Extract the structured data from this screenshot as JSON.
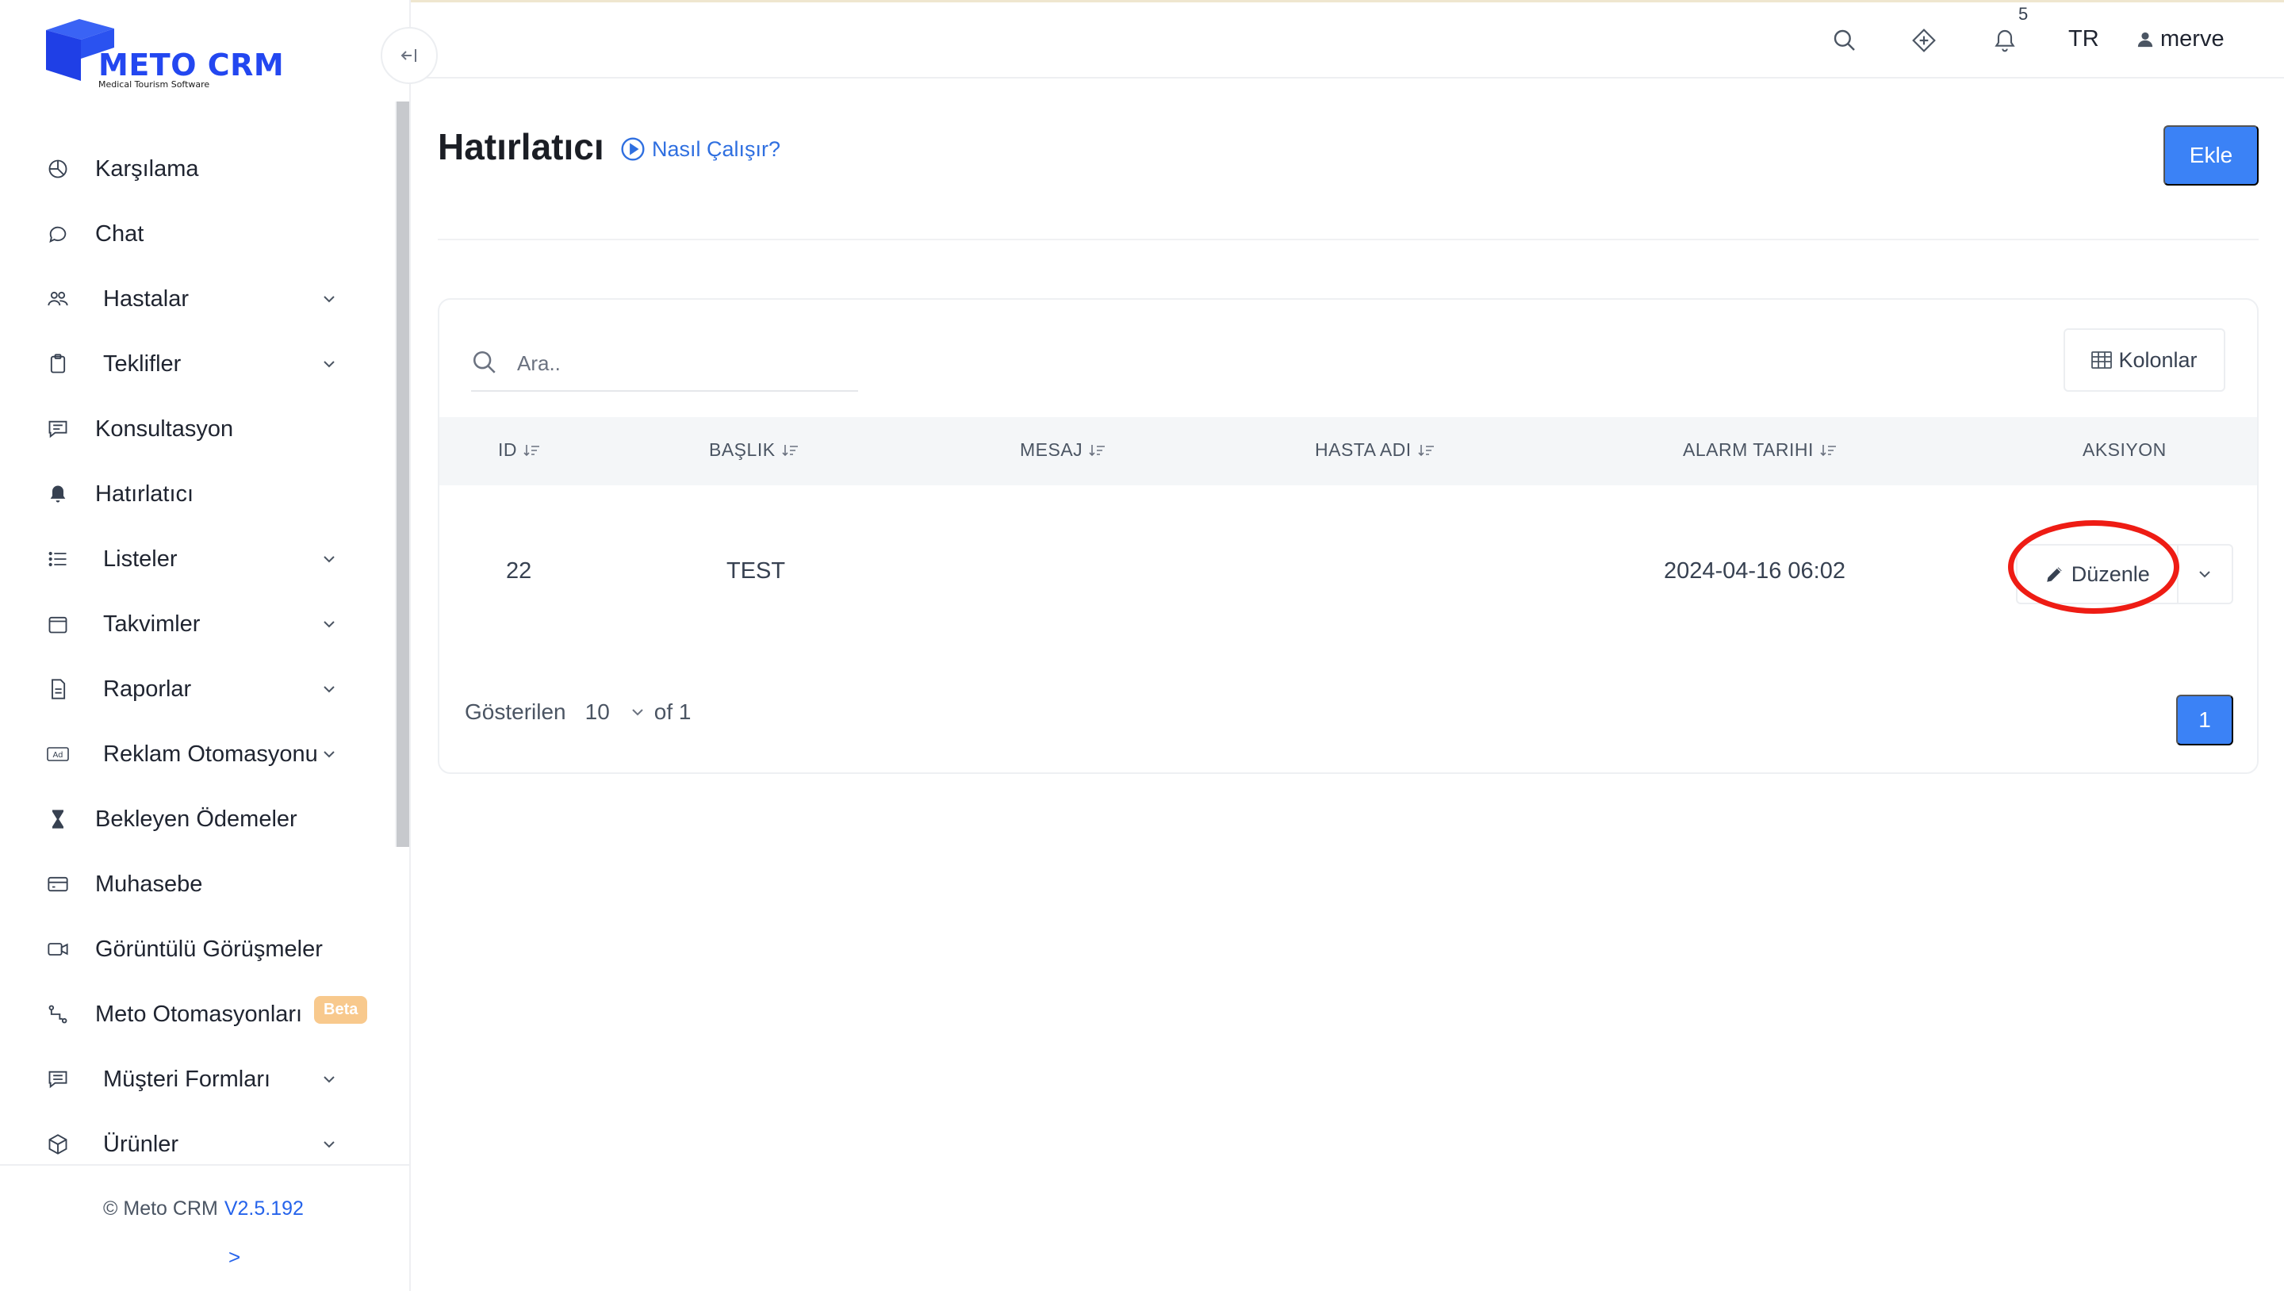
{
  "brand": {
    "name": "METO CRM",
    "tagline": "Medical Tourism Software"
  },
  "colors": {
    "primary": "#3b82f6",
    "brand": "#2347f0",
    "beta_badge": "#f8c98d",
    "highlight": "#ee1c14"
  },
  "sidebar": {
    "items": [
      {
        "label": "Karşılama",
        "icon": "dashboard-icon",
        "has_children": false
      },
      {
        "label": "Chat",
        "icon": "chat-icon",
        "has_children": false
      },
      {
        "label": "Hastalar",
        "icon": "patients-icon",
        "has_children": true
      },
      {
        "label": "Teklifler",
        "icon": "clipboard-icon",
        "has_children": true
      },
      {
        "label": "Konsultasyon",
        "icon": "message-icon",
        "has_children": false
      },
      {
        "label": "Hatırlatıcı",
        "icon": "bell-icon",
        "has_children": false,
        "active": true
      },
      {
        "label": "Listeler",
        "icon": "list-icon",
        "has_children": true
      },
      {
        "label": "Takvimler",
        "icon": "calendar-icon",
        "has_children": true
      },
      {
        "label": "Raporlar",
        "icon": "report-icon",
        "has_children": true
      },
      {
        "label": "Reklam Otomasyonu",
        "icon": "ad-icon",
        "has_children": true
      },
      {
        "label": "Bekleyen Ödemeler",
        "icon": "hourglass-icon",
        "has_children": false
      },
      {
        "label": "Muhasebe",
        "icon": "credit-card-icon",
        "has_children": false
      },
      {
        "label": "Görüntülü Görüşmeler",
        "icon": "video-icon",
        "has_children": false
      },
      {
        "label": "Meto Otomasyonları",
        "icon": "automation-icon",
        "has_children": false,
        "badge": "Beta"
      },
      {
        "label": "Müşteri Formları",
        "icon": "form-icon",
        "has_children": true
      },
      {
        "label": "Ürünler",
        "icon": "box-icon",
        "has_children": true
      }
    ],
    "footer": {
      "copyright": "© Meto CRM",
      "version": "V2.5.192",
      "expand": ">"
    }
  },
  "header": {
    "notification_count": "5",
    "language": "TR",
    "username": "merve"
  },
  "page": {
    "title": "Hatırlatıcı",
    "how_it_works": "Nasıl Çalışır?",
    "add_button": "Ekle"
  },
  "table": {
    "search_placeholder": "Ara..",
    "columns_button": "Kolonlar",
    "columns": [
      "ID",
      "BAŞLIK",
      "MESAJ",
      "HASTA ADI",
      "ALARM TARIHI",
      "AKSIYON"
    ],
    "rows": [
      {
        "id": "22",
        "title": "TEST",
        "message": "",
        "patient": "",
        "alarm_date": "2024-04-16 06:02",
        "action": "Düzenle"
      }
    ],
    "footer": {
      "shown_label": "Gösterilen",
      "page_size": "10",
      "of_label": "of 1",
      "current_page": "1"
    }
  }
}
